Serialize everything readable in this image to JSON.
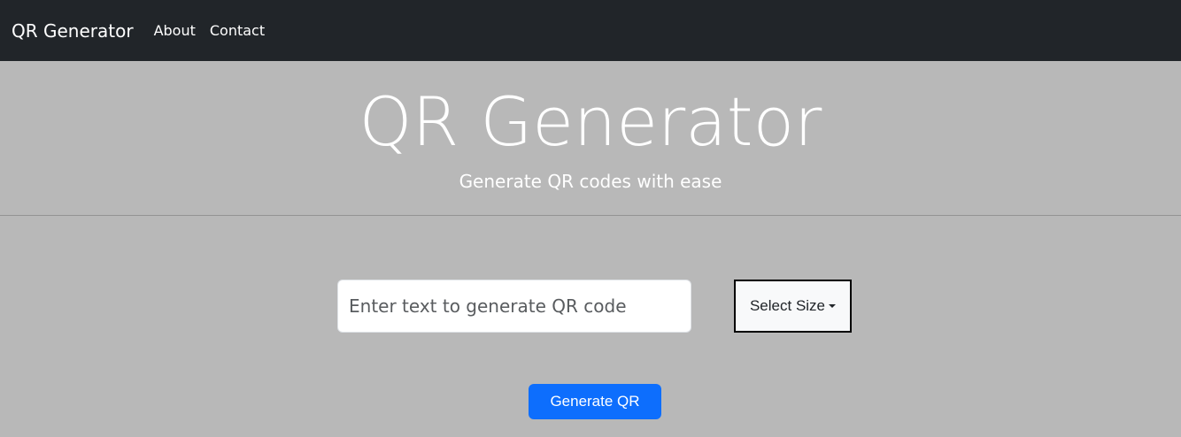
{
  "navbar": {
    "brand": "QR Generator",
    "links": [
      {
        "label": "About"
      },
      {
        "label": "Contact"
      }
    ],
    "background": "#212529"
  },
  "hero": {
    "title": "QR Generator",
    "subtitle": "Generate QR codes with ease"
  },
  "form": {
    "text_input": {
      "value": "",
      "placeholder": "Enter text to generate QR code"
    },
    "size_dropdown": {
      "label": "Select Size",
      "icon": "caret-down-icon"
    },
    "generate_button": {
      "label": "Generate QR",
      "color": "#0d6efd"
    }
  },
  "colors": {
    "page_background": "#b8b8b8",
    "accent": "#0d6efd"
  }
}
